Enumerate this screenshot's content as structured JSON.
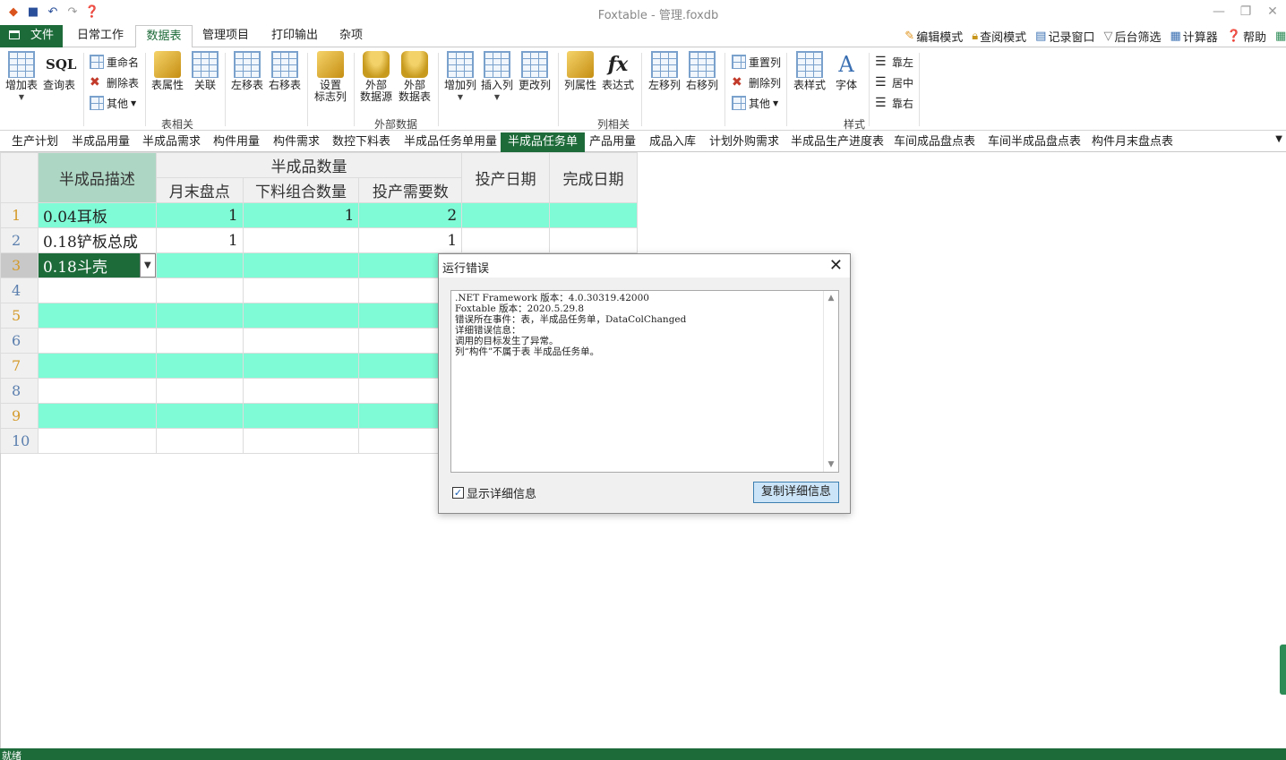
{
  "window": {
    "title": "Foxtable - 管理.foxdb",
    "controls": [
      "—",
      "❐",
      "✕"
    ]
  },
  "menu": {
    "file": "文件",
    "tabs": [
      "日常工作",
      "数据表",
      "管理项目",
      "打印输出",
      "杂项"
    ],
    "active_tab": "数据表",
    "modes": [
      "编辑模式",
      "查阅模式",
      "记录窗口",
      "后台筛选",
      "计算器",
      "帮助"
    ]
  },
  "ribbon": {
    "add_table": "增加表",
    "query_table": "查询表",
    "rename": "重命名",
    "delete_table": "删除表",
    "other": "其他",
    "table_props": "表属性",
    "relation": "关联",
    "move_left": "左移表",
    "move_right": "右移表",
    "set_flag_col_1": "设置",
    "set_flag_col_2": "标志列",
    "ext_source_1": "外部",
    "ext_source_2": "数据源",
    "ext_table_1": "外部",
    "ext_table_2": "数据表",
    "add_col": "增加列",
    "insert_col": "插入列",
    "change_col": "更改列",
    "col_props": "列属性",
    "expr_col": "表达式",
    "col_left": "左移列",
    "col_right": "右移列",
    "reset_col": "重置列",
    "delete_col": "删除列",
    "col_other": "其他",
    "table_style": "表样式",
    "font": "字体",
    "align_left": "靠左",
    "align_center": "居中",
    "align_right": "靠右",
    "groups": {
      "table": "表相关",
      "external": "外部数据",
      "column": "列相关",
      "style": "样式"
    }
  },
  "table_tabs": [
    "生产计划",
    "半成品用量",
    "半成品需求",
    "构件用量",
    "构件需求",
    "数控下料表",
    "半成品任务单用量",
    "半成品任务单",
    "产品用量",
    "成品入库",
    "计划外购需求",
    "半成品生产进度表",
    "车间成品盘点表",
    "车间半成品盘点表",
    "构件月末盘点表"
  ],
  "active_table_tab": "半成品任务单",
  "grid": {
    "headers": {
      "desc": "半成品描述",
      "qty_group": "半成品数量",
      "month_end": "月末盘点",
      "cut_combo": "下料组合数量",
      "need": "投产需要数",
      "start_date": "投产日期",
      "finish_date": "完成日期"
    },
    "rows": [
      {
        "n": "1",
        "desc": "0.04耳板",
        "month_end": "1",
        "cut_combo": "1",
        "need": "2"
      },
      {
        "n": "2",
        "desc": "0.18铲板总成",
        "month_end": "1",
        "cut_combo": "",
        "need": "1"
      },
      {
        "n": "3",
        "desc": "0.18斗壳",
        "month_end": "",
        "cut_combo": "",
        "need": ""
      },
      {
        "n": "4",
        "desc": "",
        "month_end": "",
        "cut_combo": "",
        "need": ""
      },
      {
        "n": "5",
        "desc": "",
        "month_end": "",
        "cut_combo": "",
        "need": ""
      },
      {
        "n": "6",
        "desc": "",
        "month_end": "",
        "cut_combo": "",
        "need": ""
      },
      {
        "n": "7",
        "desc": "",
        "month_end": "",
        "cut_combo": "",
        "need": ""
      },
      {
        "n": "8",
        "desc": "",
        "month_end": "",
        "cut_combo": "",
        "need": ""
      },
      {
        "n": "9",
        "desc": "",
        "month_end": "",
        "cut_combo": "",
        "need": ""
      },
      {
        "n": "10",
        "desc": "",
        "month_end": "",
        "cut_combo": "",
        "need": ""
      }
    ]
  },
  "dialog": {
    "title": "运行错误",
    "detail": ".NET Framework 版本：4.0.30319.42000\nFoxtable 版本：2020.5.29.8\n错误所在事件：表，半成品任务单，DataColChanged\n详细错误信息：\n调用的目标发生了异常。\n列“构件”不属于表 半成品任务单。",
    "show_detail_label": "显示详细信息",
    "show_detail_checked": true,
    "copy_button": "复制详细信息"
  },
  "status": {
    "text": "就绪"
  },
  "colors": {
    "accent": "#1e6b3a",
    "row_highlight": "#7ffbd5"
  }
}
